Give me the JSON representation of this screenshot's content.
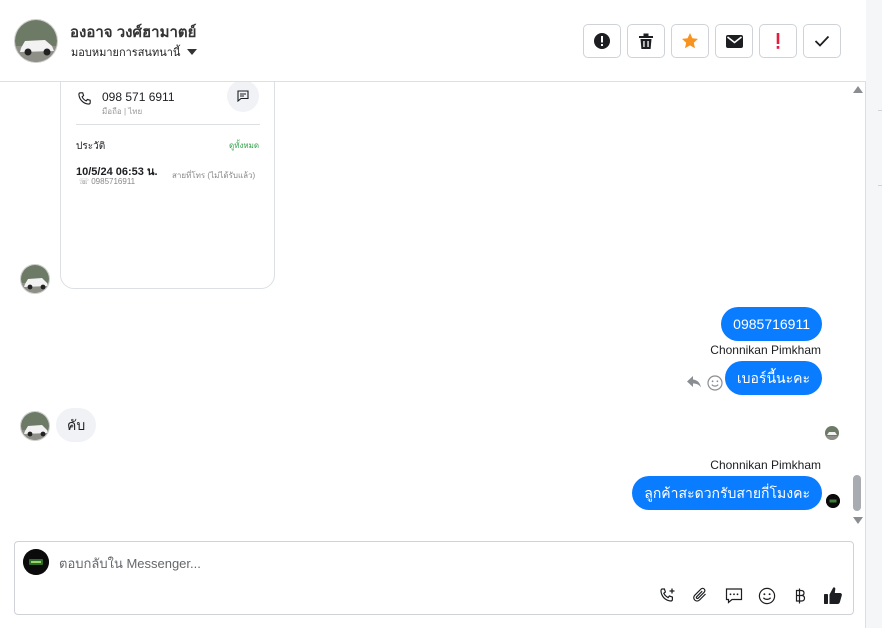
{
  "header": {
    "contact_name": "องอาจ วงศ์ฮามาตย์",
    "assign_label": "มอบหมายการสนทนานี้",
    "actions": [
      {
        "name": "spam-button",
        "icon": "alert-circle-icon"
      },
      {
        "name": "delete-button",
        "icon": "trash-icon"
      },
      {
        "name": "star-button",
        "icon": "star-icon"
      },
      {
        "name": "mark-unread-button",
        "icon": "envelope-icon"
      },
      {
        "name": "important-button",
        "icon": "exclamation-icon"
      },
      {
        "name": "done-button",
        "icon": "checkmark-icon"
      }
    ]
  },
  "card": {
    "phone": "098 571 6911",
    "phone_sub": "มือถือ | ไทย",
    "history_label": "ประวัติ",
    "history_link": "ดูทั้งหมด",
    "call_datetime": "10/5/24 06:53 น.",
    "call_number": "0985716911",
    "call_status": "สายที่โทร (ไม่ได้รับแล้ว)"
  },
  "messages": {
    "m1": "0985716911",
    "sender1": "Chonnikan Pimkham",
    "m2": "เบอร์นี้นะคะ",
    "m3_in": "คับ",
    "sender2": "Chonnikan Pimkham",
    "m4": "ลูกค้าสะดวกรับสายกี่โมงคะ"
  },
  "composer": {
    "placeholder": "ตอบกลับใน Messenger..."
  },
  "colors": {
    "accent": "#0a7cff",
    "star": "#f7931e",
    "danger": "#e41e3f"
  }
}
